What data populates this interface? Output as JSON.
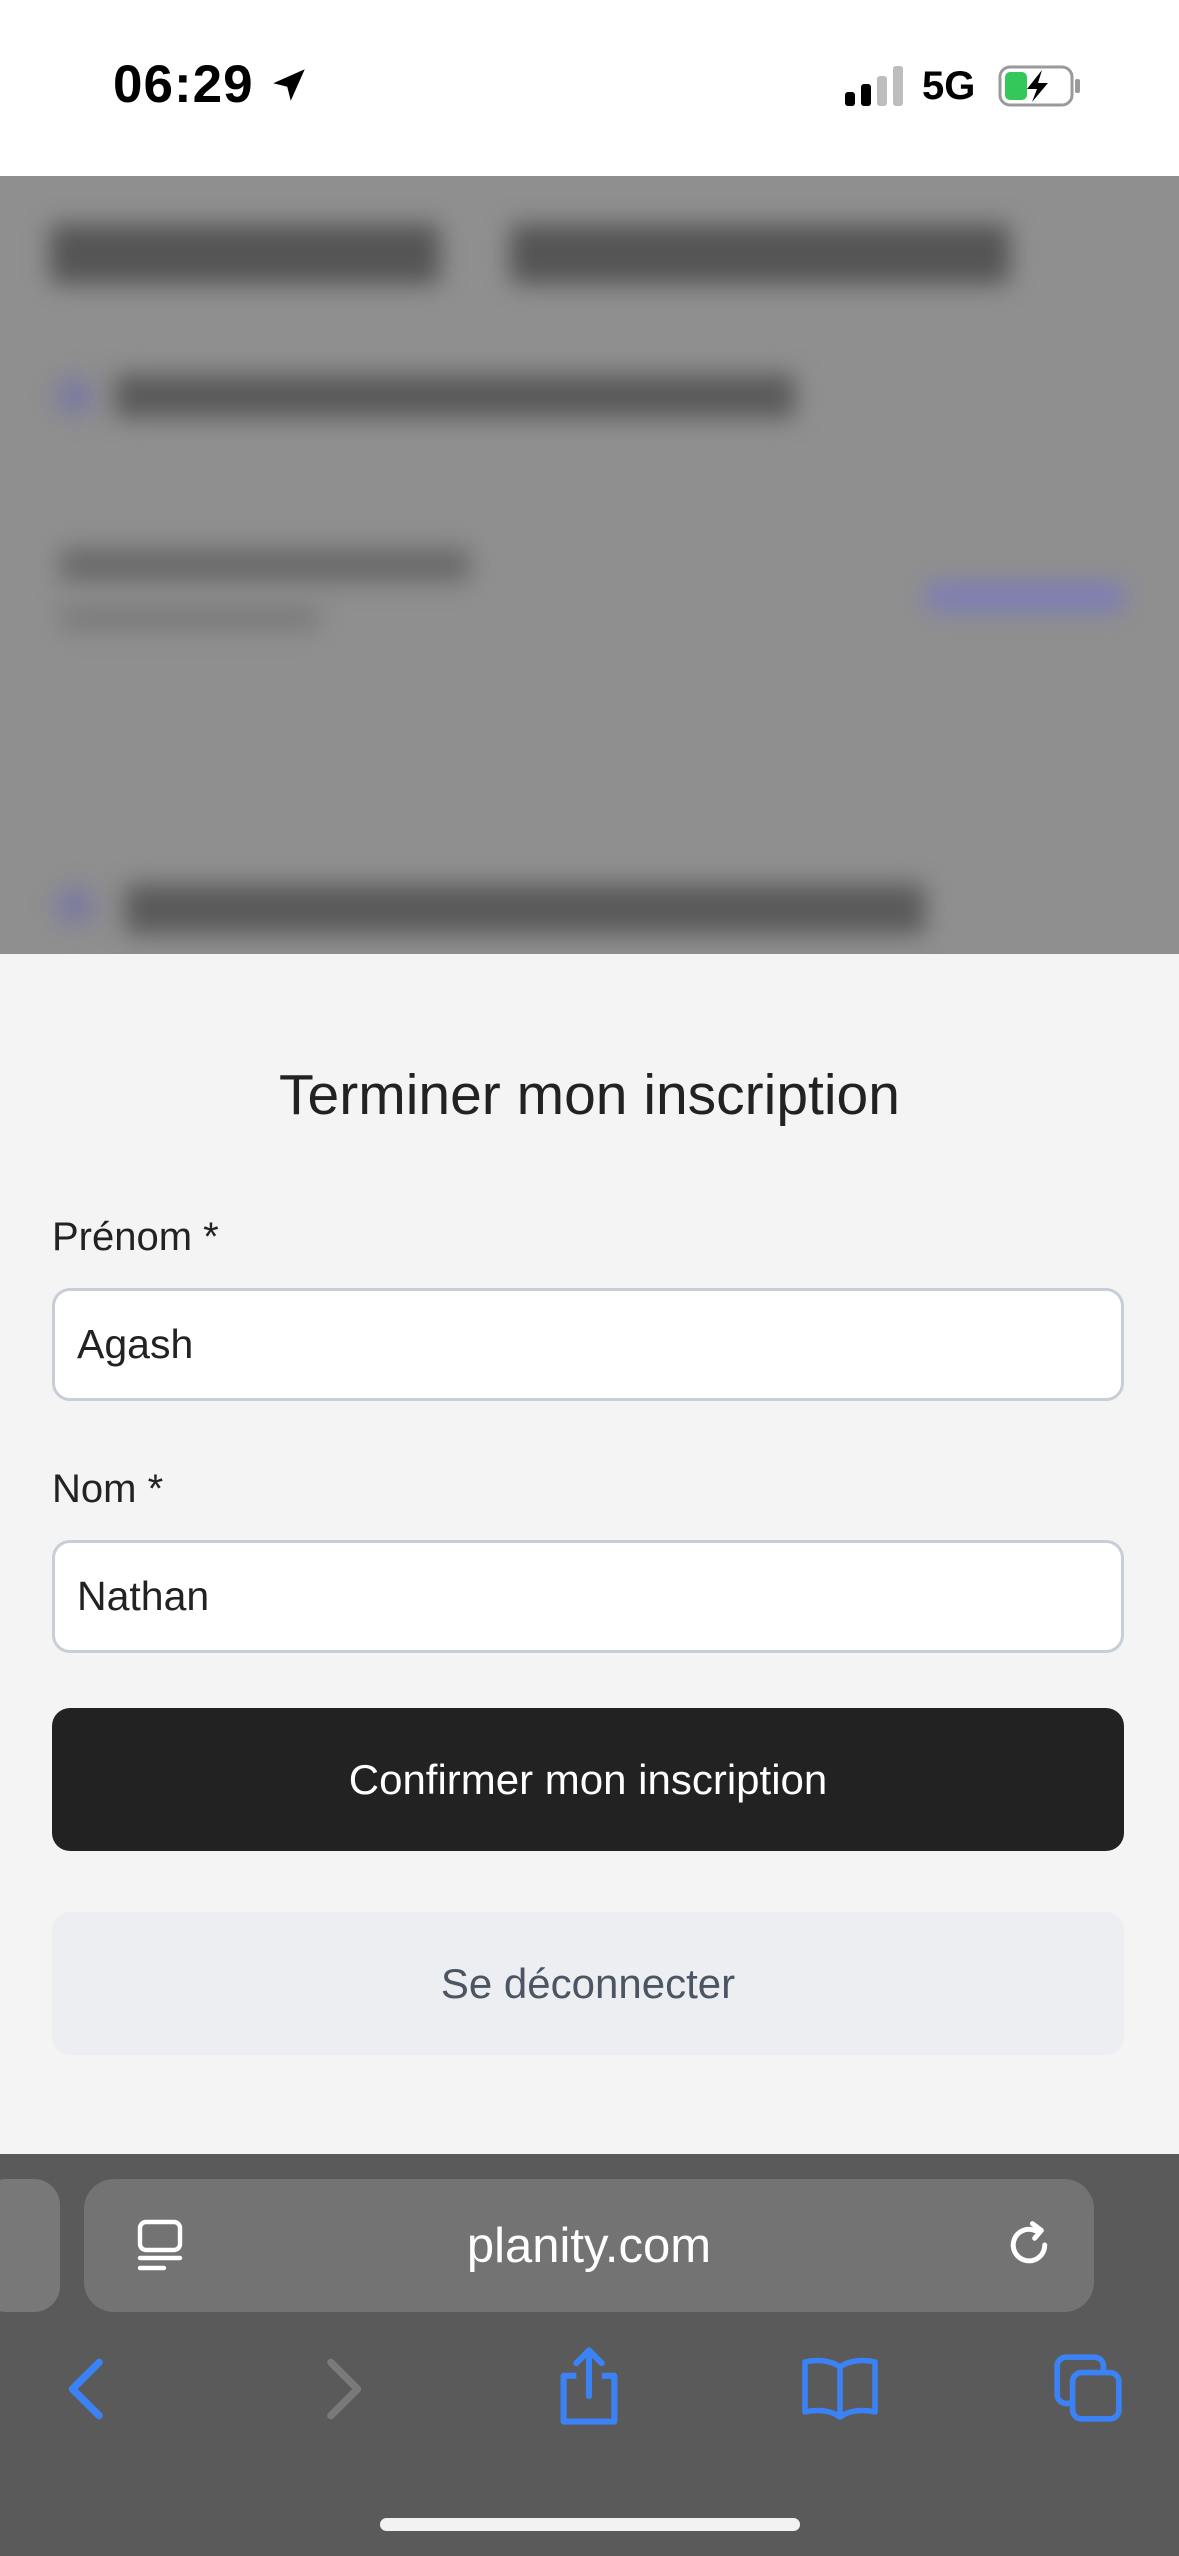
{
  "status_bar": {
    "time": "06:29",
    "network": "5G"
  },
  "modal": {
    "title": "Terminer mon inscription",
    "first_name": {
      "label": "Prénom *",
      "value": "Agash"
    },
    "last_name": {
      "label": "Nom *",
      "value": "Nathan"
    },
    "confirm_label": "Confirmer mon inscription",
    "logout_label": "Se déconnecter"
  },
  "browser": {
    "url": "planity.com"
  },
  "colors": {
    "primary_button": "#222222",
    "secondary_button": "#eceef1",
    "link_blue": "#3b82f6"
  },
  "icons": [
    "location-arrow-icon",
    "signal-icon",
    "battery-charging-icon",
    "reader-icon",
    "reload-icon",
    "back-icon",
    "forward-icon",
    "share-icon",
    "bookmarks-icon",
    "tabs-icon"
  ]
}
